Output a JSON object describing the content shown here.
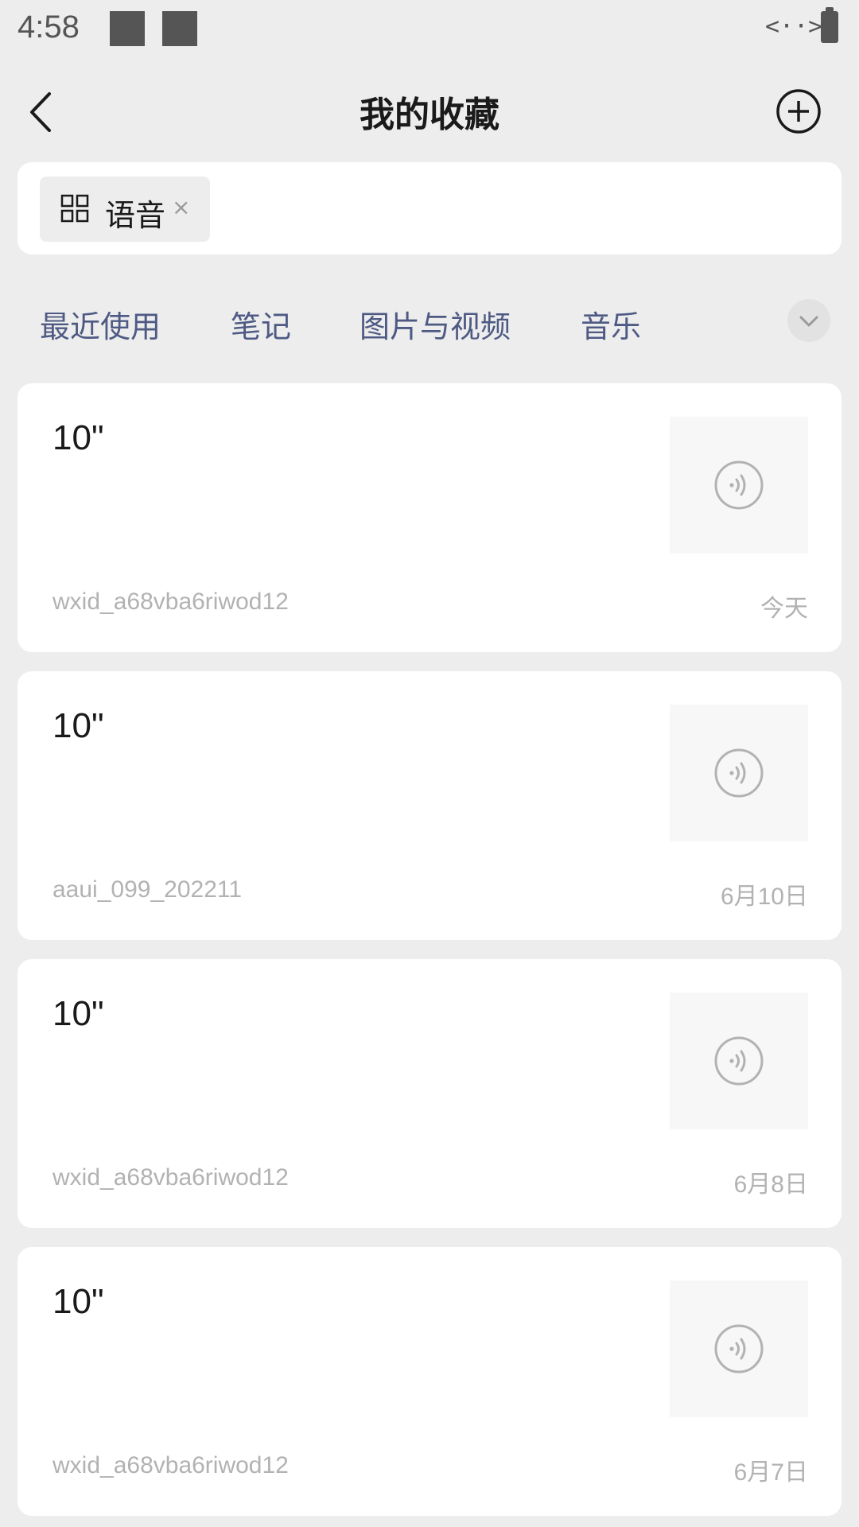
{
  "status_bar": {
    "time": "4:58",
    "data_indicator": "<··>"
  },
  "header": {
    "title": "我的收藏"
  },
  "filter": {
    "chip_label": "语音",
    "chip_close": "×"
  },
  "categories": [
    "最近使用",
    "笔记",
    "图片与视频",
    "音乐"
  ],
  "items": [
    {
      "duration": "10\"",
      "source": "wxid_a68vba6riwod12",
      "date": "今天"
    },
    {
      "duration": "10\"",
      "source": "aaui_099_202211",
      "date": "6月10日"
    },
    {
      "duration": "10\"",
      "source": "wxid_a68vba6riwod12",
      "date": "6月8日"
    },
    {
      "duration": "10\"",
      "source": "wxid_a68vba6riwod12",
      "date": "6月7日"
    }
  ],
  "colors": {
    "background": "#ededed",
    "card": "#ffffff",
    "tab_text": "#4e5a83",
    "meta_text": "#b2b2b2",
    "icon_gray": "#b2b2b2"
  }
}
